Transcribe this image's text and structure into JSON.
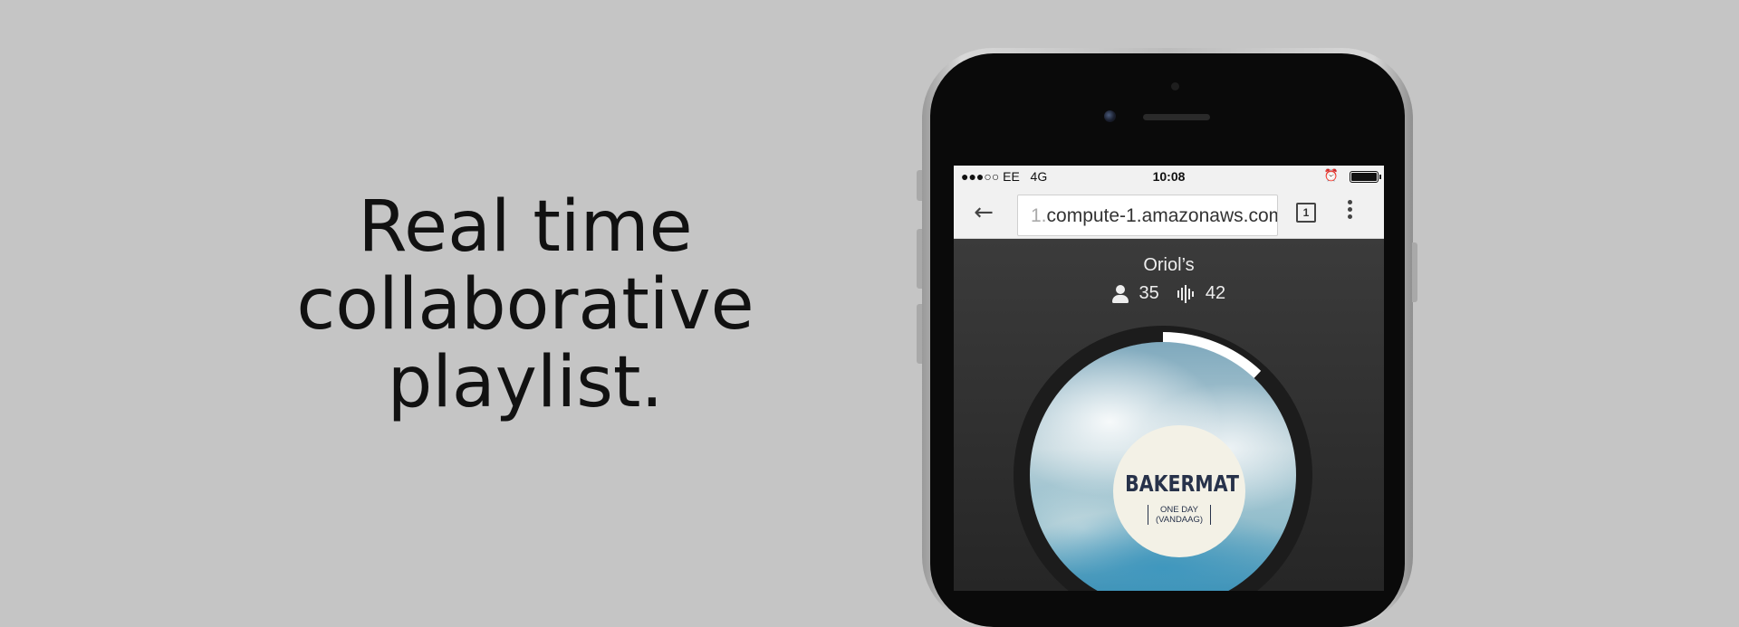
{
  "tagline": [
    "Real time",
    "collaborative",
    "playlist."
  ],
  "status_bar": {
    "carrier": "●●●○○ EE",
    "network": "4G",
    "time": "10:08"
  },
  "browser": {
    "url_prefix": "1.",
    "url_main": "compute-1.amazonaws.com",
    "tab_count": "1"
  },
  "playlist": {
    "room_name": "Oriol’s",
    "listeners": "35",
    "tracks": "42",
    "progress_fraction": 0.12
  },
  "now_playing": {
    "artist": "BAKERMAT",
    "track_line1": "ONE DAY",
    "track_line2": "(VANDAAG)"
  },
  "colors": {
    "background": "#c5c5c5",
    "progress_ring": "#ffffff",
    "ring_track": "#1c1c1c",
    "label_text": "#27324a"
  }
}
